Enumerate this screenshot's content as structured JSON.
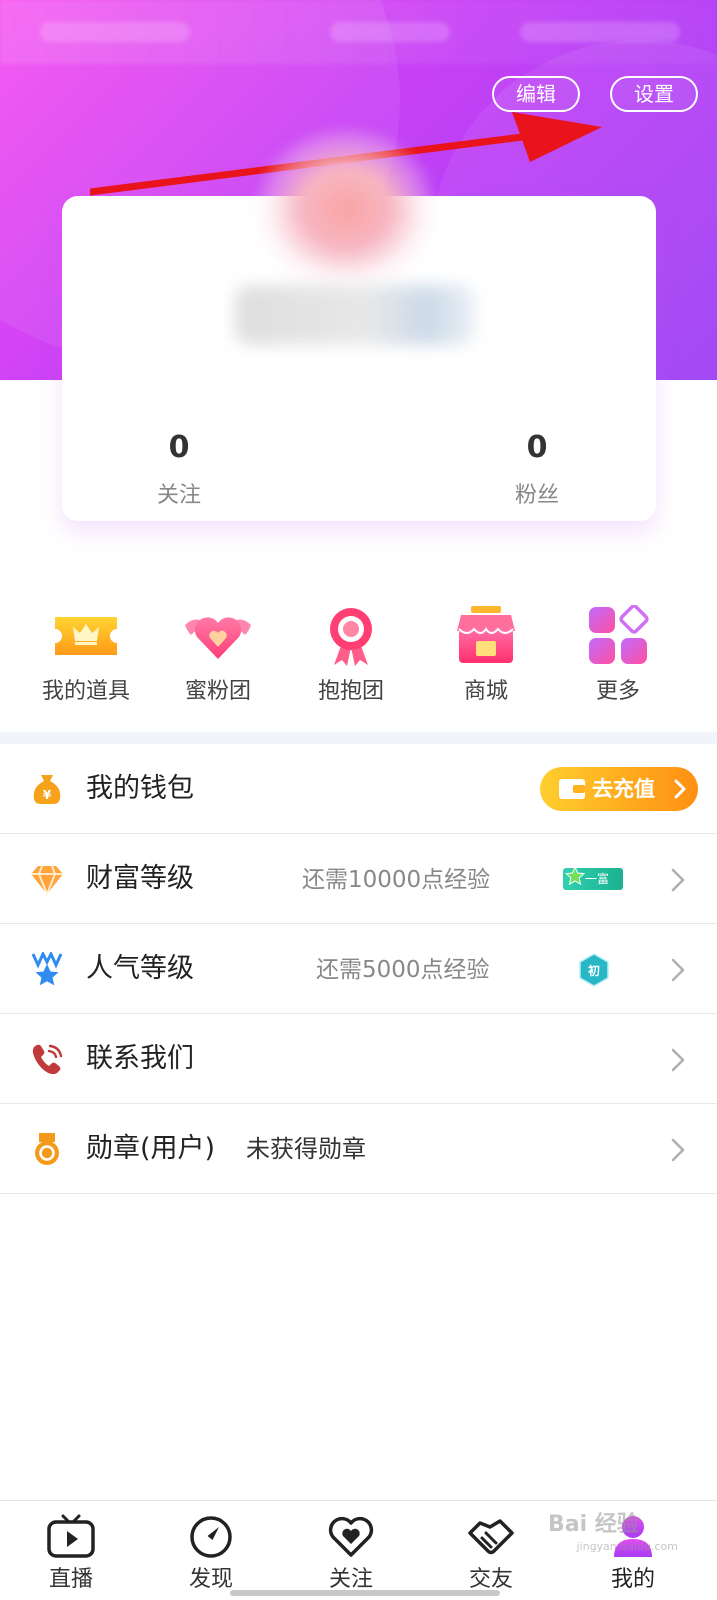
{
  "header": {
    "edit_label": "编辑",
    "settings_label": "设置",
    "gradient_start": "#f64ef0",
    "gradient_end": "#9b3df5",
    "annotation_arrow_color": "#e8131b"
  },
  "profile": {
    "following_count": "0",
    "following_label": "关注",
    "fans_count": "0",
    "fans_label": "粉丝"
  },
  "quick_actions": [
    {
      "label": "我的道具",
      "icon": "ticket-crown-icon"
    },
    {
      "label": "蜜粉团",
      "icon": "winged-heart-icon"
    },
    {
      "label": "抱抱团",
      "icon": "ribbon-badge-icon"
    },
    {
      "label": "商城",
      "icon": "shop-icon"
    },
    {
      "label": "更多",
      "icon": "more-grid-icon"
    }
  ],
  "menu": {
    "wallet": {
      "title": "我的钱包",
      "icon": "money-bag-icon",
      "button": "去充值"
    },
    "wealth": {
      "title": "财富等级",
      "subtitle": "还需10000点经验",
      "badge": "一富",
      "icon": "diamond-icon"
    },
    "popularity": {
      "title": "人气等级",
      "subtitle": "还需5000点经验",
      "badge": "初",
      "icon": "star-medal-icon"
    },
    "contact": {
      "title": "联系我们",
      "icon": "phone-icon"
    },
    "medals": {
      "title": "勋章(用户)",
      "info": "未获得勋章",
      "icon": "medal-icon"
    }
  },
  "tabbar": {
    "items": [
      {
        "label": "直播",
        "icon": "tv-play-icon"
      },
      {
        "label": "发现",
        "icon": "compass-icon"
      },
      {
        "label": "关注",
        "icon": "heart-icon"
      },
      {
        "label": "交友",
        "icon": "handshake-icon"
      },
      {
        "label": "我的",
        "icon": "user-icon",
        "active": true
      }
    ],
    "active_color": "#c53cf0"
  },
  "watermark": {
    "text": "Bai 经验",
    "sub": "jingyan.baidu.com"
  }
}
